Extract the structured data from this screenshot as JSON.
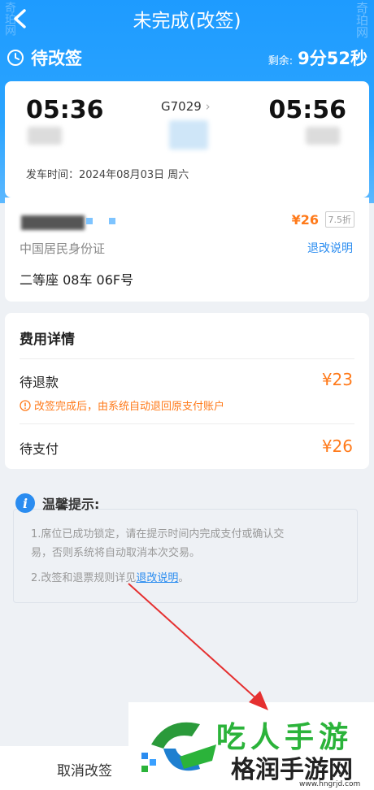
{
  "nav": {
    "title": "未完成(改签)"
  },
  "status": {
    "title": "待改签",
    "remaining_label": "剩余:",
    "remaining_value": "9分52秒"
  },
  "trip": {
    "depart_time": "05:36",
    "arrive_time": "05:56",
    "train_no": "G7029",
    "train_chevron": "›",
    "depart_info": "发车时间：2024年08月03日 周六"
  },
  "passenger": {
    "price": "¥26",
    "discount": "7.5折",
    "id_type": "中国居民身份证",
    "rule_link": "退改说明",
    "seat": "二等座 08车 06F号"
  },
  "fees": {
    "title": "费用详情",
    "refund_label": "待退款",
    "refund_value": "¥23",
    "refund_note": "改签完成后，由系统自动退回原支付账户",
    "pay_label": "待支付",
    "pay_value": "¥26"
  },
  "tips": {
    "title": "温馨提示:",
    "line1a": "1.席位已成功锁定，请在提示时间内完成支付或确认交",
    "line1b": "易，否则系统将自动取消本次交易。",
    "line2_prefix": "2.改签和退票规则详见",
    "line2_link": "退改说明",
    "line2_suffix": "。"
  },
  "bottom": {
    "cancel_label": "取消改签"
  },
  "watermark": {
    "big": "吃人手游",
    "name": "格润手游网",
    "url": "www.hngrjd.com",
    "corner_right": "奇珀网",
    "corner_left": "奇珀网"
  },
  "colors": {
    "brand_blue": "#1e9bff",
    "accent_orange": "#ff7a1a",
    "link_blue": "#2a8cf0"
  }
}
